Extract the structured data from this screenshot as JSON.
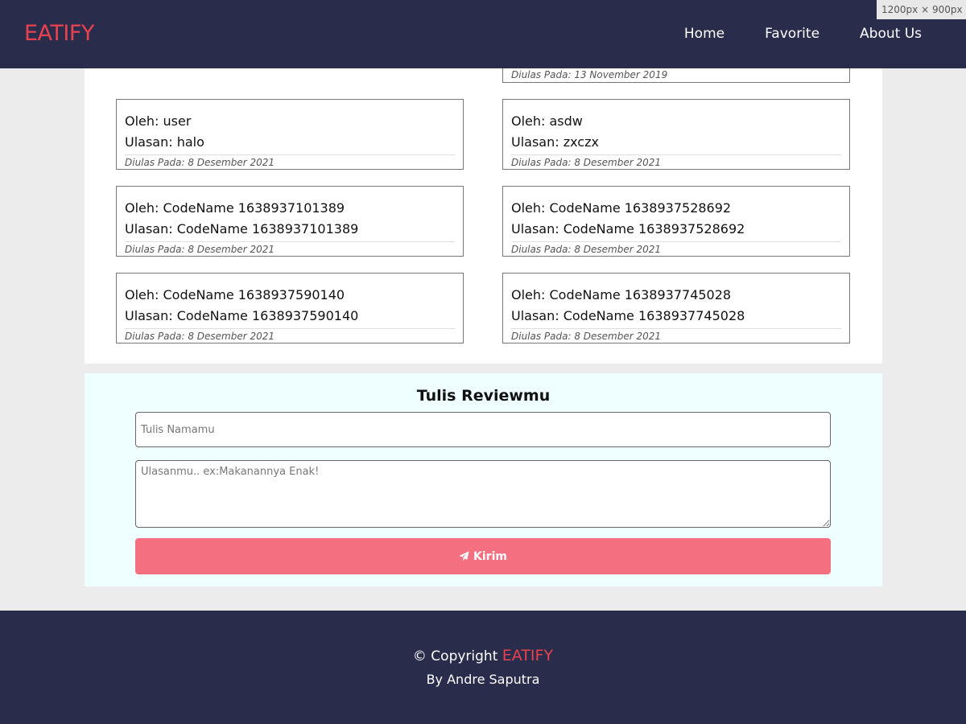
{
  "app": {
    "brand": "EATIFY"
  },
  "viewport_badge": "1200px × 900px",
  "nav": {
    "items": [
      "Home",
      "Favorite",
      "About Us"
    ]
  },
  "reviews": {
    "partial_top": {
      "date": "Diulas Pada: 13 November 2019"
    },
    "items": [
      {
        "oleh": "Oleh: user",
        "ulasan": "Ulasan: halo",
        "date": "Diulas Pada: 8 Desember 2021"
      },
      {
        "oleh": "Oleh: asdw",
        "ulasan": "Ulasan: zxczx",
        "date": "Diulas Pada: 8 Desember 2021"
      },
      {
        "oleh": "Oleh: CodeName 1638937101389",
        "ulasan": "Ulasan: CodeName 1638937101389",
        "date": "Diulas Pada: 8 Desember 2021"
      },
      {
        "oleh": "Oleh: CodeName 1638937528692",
        "ulasan": "Ulasan: CodeName 1638937528692",
        "date": "Diulas Pada: 8 Desember 2021"
      },
      {
        "oleh": "Oleh: CodeName 1638937590140",
        "ulasan": "Ulasan: CodeName 1638937590140",
        "date": "Diulas Pada: 8 Desember 2021"
      },
      {
        "oleh": "Oleh: CodeName 1638937745028",
        "ulasan": "Ulasan: CodeName 1638937745028",
        "date": "Diulas Pada: 8 Desember 2021"
      }
    ]
  },
  "review_form": {
    "title": "Tulis Reviewmu",
    "name_value": "",
    "name_placeholder": "Tulis Namamu",
    "review_value": "",
    "review_placeholder": "Ulasanmu.. ex:Makanannya Enak!",
    "submit_label": "Kirim",
    "submit_icon": "paper-plane-icon"
  },
  "footer": {
    "copyright_prefix": "© Copyright",
    "brand": "EATIFY",
    "by_line": "By Andre Saputra"
  },
  "colors": {
    "header_bg": "#2a2c4c",
    "brand": "#e8414f",
    "page_bg": "#ececec",
    "form_bg": "#effefe",
    "submit_bg": "#f47080"
  }
}
